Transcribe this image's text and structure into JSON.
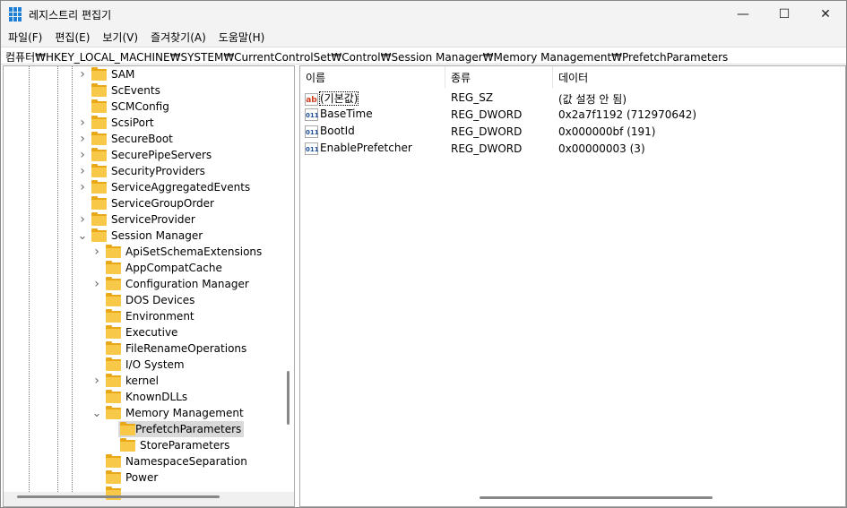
{
  "window": {
    "title": "레지스트리 편집기",
    "minimize": "—",
    "maximize": "☐",
    "close": "✕"
  },
  "menu": [
    "파일(F)",
    "편집(E)",
    "보기(V)",
    "즐겨찾기(A)",
    "도움말(H)"
  ],
  "address": "컴퓨터₩HKEY_LOCAL_MACHINE₩SYSTEM₩CurrentControlSet₩Control₩Session Manager₩Memory Management₩PrefetchParameters",
  "tree": [
    {
      "label": "SAM",
      "level": 0,
      "arrow": "right"
    },
    {
      "label": "ScEvents",
      "level": 0,
      "arrow": ""
    },
    {
      "label": "SCMConfig",
      "level": 0,
      "arrow": ""
    },
    {
      "label": "ScsiPort",
      "level": 0,
      "arrow": "right"
    },
    {
      "label": "SecureBoot",
      "level": 0,
      "arrow": "right"
    },
    {
      "label": "SecurePipeServers",
      "level": 0,
      "arrow": "right"
    },
    {
      "label": "SecurityProviders",
      "level": 0,
      "arrow": "right"
    },
    {
      "label": "ServiceAggregatedEvents",
      "level": 0,
      "arrow": "right"
    },
    {
      "label": "ServiceGroupOrder",
      "level": 0,
      "arrow": ""
    },
    {
      "label": "ServiceProvider",
      "level": 0,
      "arrow": "right"
    },
    {
      "label": "Session Manager",
      "level": 0,
      "arrow": "down"
    },
    {
      "label": "ApiSetSchemaExtensions",
      "level": 1,
      "arrow": "right"
    },
    {
      "label": "AppCompatCache",
      "level": 1,
      "arrow": ""
    },
    {
      "label": "Configuration Manager",
      "level": 1,
      "arrow": "right"
    },
    {
      "label": "DOS Devices",
      "level": 1,
      "arrow": ""
    },
    {
      "label": "Environment",
      "level": 1,
      "arrow": ""
    },
    {
      "label": "Executive",
      "level": 1,
      "arrow": ""
    },
    {
      "label": "FileRenameOperations",
      "level": 1,
      "arrow": ""
    },
    {
      "label": "I/O System",
      "level": 1,
      "arrow": ""
    },
    {
      "label": "kernel",
      "level": 1,
      "arrow": "right"
    },
    {
      "label": "KnownDLLs",
      "level": 1,
      "arrow": ""
    },
    {
      "label": "Memory Management",
      "level": 1,
      "arrow": "down"
    },
    {
      "label": "PrefetchParameters",
      "level": 2,
      "arrow": "",
      "selected": true
    },
    {
      "label": "StoreParameters",
      "level": 2,
      "arrow": ""
    },
    {
      "label": "NamespaceSeparation",
      "level": 1,
      "arrow": ""
    },
    {
      "label": "Power",
      "level": 1,
      "arrow": ""
    },
    {
      "label": "",
      "level": 1,
      "arrow": ""
    }
  ],
  "list": {
    "headers": [
      "이름",
      "종류",
      "데이터"
    ],
    "rows": [
      {
        "icon": "string-value-icon",
        "name": "(기본값)",
        "type": "REG_SZ",
        "data": "(값 설정 안 됨)"
      },
      {
        "icon": "binary-value-icon",
        "name": "BaseTime",
        "type": "REG_DWORD",
        "data": "0x2a7f1192 (712970642)"
      },
      {
        "icon": "binary-value-icon",
        "name": "BootId",
        "type": "REG_DWORD",
        "data": "0x000000bf (191)"
      },
      {
        "icon": "binary-value-icon",
        "name": "EnablePrefetcher",
        "type": "REG_DWORD",
        "data": "0x00000003 (3)"
      }
    ]
  }
}
